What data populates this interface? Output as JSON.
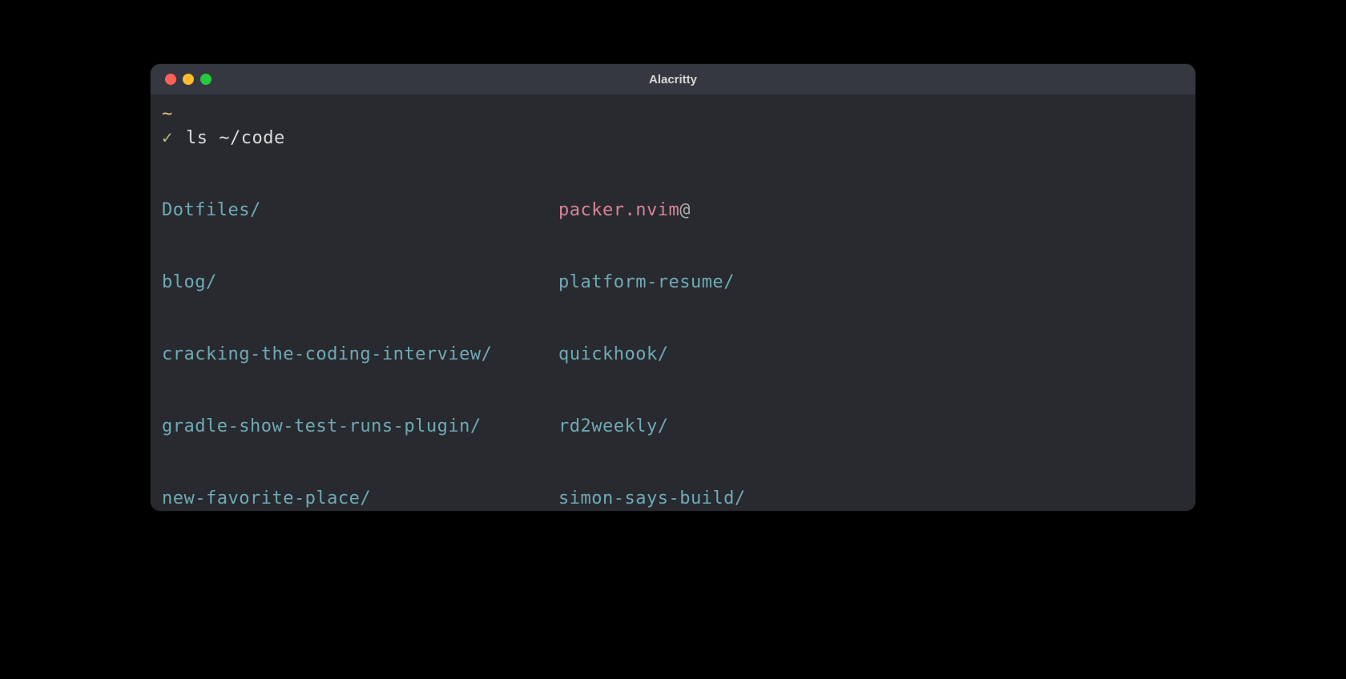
{
  "window": {
    "title": "Alacritty"
  },
  "prompt": {
    "cwd_indicator": "~",
    "success_indicator": "✓",
    "command": "ls ~/code"
  },
  "listing": {
    "col1": [
      {
        "name": "Dotfiles",
        "type": "dir",
        "suffix": "/"
      },
      {
        "name": "blog",
        "type": "dir",
        "suffix": "/"
      },
      {
        "name": "cracking-the-coding-interview",
        "type": "dir",
        "suffix": "/"
      },
      {
        "name": "gradle-show-test-runs-plugin",
        "type": "dir",
        "suffix": "/"
      },
      {
        "name": "new-favorite-place",
        "type": "dir",
        "suffix": "/"
      }
    ],
    "col2": [
      {
        "name": "packer.nvim",
        "type": "symlink",
        "suffix": "@"
      },
      {
        "name": "platform-resume",
        "type": "dir",
        "suffix": "/"
      },
      {
        "name": "quickhook",
        "type": "dir",
        "suffix": "/"
      },
      {
        "name": "rd2weekly",
        "type": "dir",
        "suffix": "/"
      },
      {
        "name": "simon-says-build",
        "type": "dir",
        "suffix": "/"
      }
    ]
  },
  "colors": {
    "background": "#282a30",
    "titlebar": "#363841",
    "dir": "#6faab4",
    "symlink": "#da8296",
    "cwd": "#e9c07b",
    "check": "#a9c37e",
    "text": "#d8ddda"
  }
}
